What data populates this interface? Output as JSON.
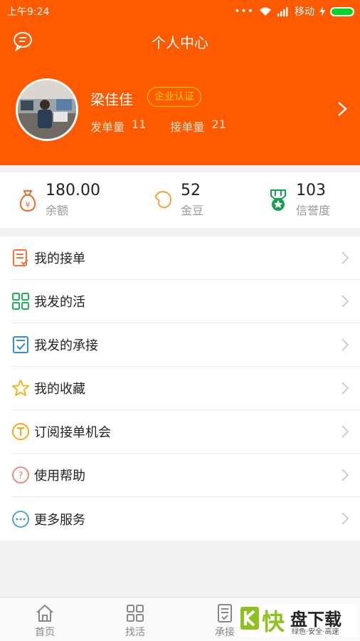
{
  "status_bar": {
    "time": "上午9:24",
    "carrier": "移动",
    "dots": "•••"
  },
  "header": {
    "title": "个人中心",
    "chat_icon": "chat-bubble-icon"
  },
  "profile": {
    "name": "梁佳佳",
    "badge": "企业认证",
    "post_label": "发单量",
    "post_count": "11",
    "take_label": "接单量",
    "take_count": "21"
  },
  "wallet": [
    {
      "value": "180.00",
      "label": "余额",
      "icon": "money-bag-icon"
    },
    {
      "value": "52",
      "label": "金豆",
      "icon": "bean-icon"
    },
    {
      "value": "103",
      "label": "信誉度",
      "icon": "medal-icon"
    }
  ],
  "menu": [
    {
      "label": "我的接单",
      "icon": "order-list-icon"
    },
    {
      "label": "我发的活",
      "icon": "grid-icon"
    },
    {
      "label": "我发的承接",
      "icon": "checklist-icon"
    },
    {
      "label": "我的收藏",
      "icon": "star-icon"
    },
    {
      "label": "订阅接单机会",
      "icon": "subscribe-icon"
    },
    {
      "label": "使用帮助",
      "icon": "help-icon"
    },
    {
      "label": "更多服务",
      "icon": "more-icon"
    }
  ],
  "tabs": [
    {
      "label": "首页",
      "icon": "home-icon"
    },
    {
      "label": "找活",
      "icon": "grid-icon"
    },
    {
      "label": "承接",
      "icon": "document-icon"
    }
  ],
  "watermark": {
    "k": "K",
    "kuai": "快",
    "pan": "盘下载",
    "sub": "绿色·安全·高速"
  },
  "colors": {
    "accent": "#ff5a00",
    "badge": "#ffd200",
    "battery": "#00d52a"
  }
}
